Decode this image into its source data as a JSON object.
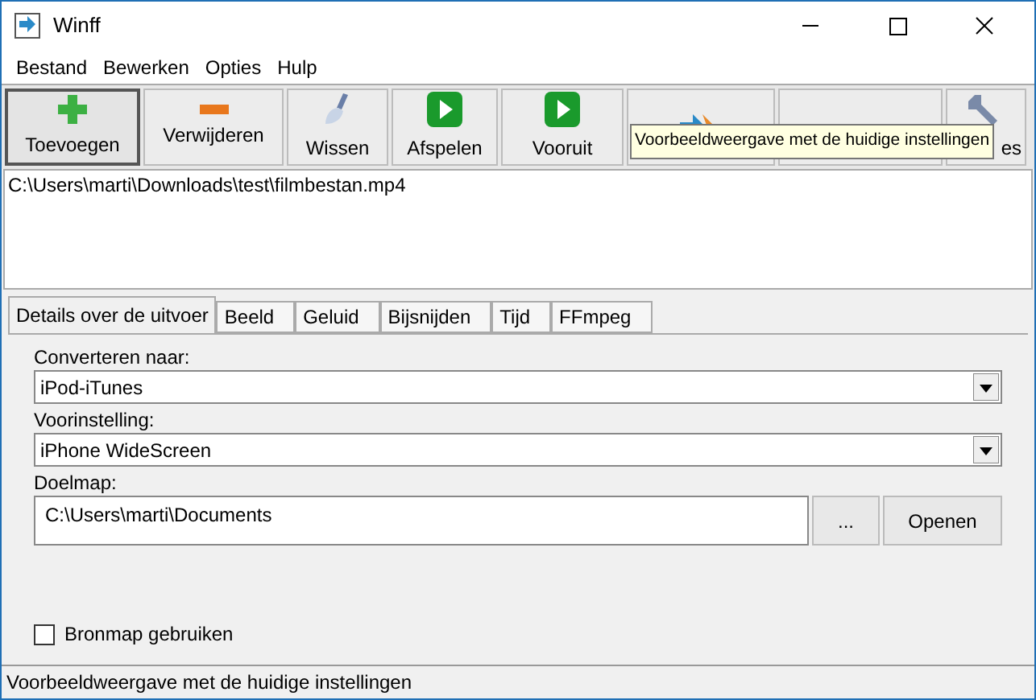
{
  "window": {
    "title": "Winff"
  },
  "menu": [
    "Bestand",
    "Bewerken",
    "Opties",
    "Hulp"
  ],
  "toolbar": [
    {
      "kind": "add",
      "label": "Toevoegen",
      "pressed": true
    },
    {
      "kind": "remove",
      "label": "Verwijderen",
      "pressed": false
    },
    {
      "kind": "clear",
      "label": "Wissen",
      "pressed": false
    },
    {
      "kind": "play",
      "label": "Afspelen",
      "pressed": false
    },
    {
      "kind": "play",
      "label": "Vooruit",
      "pressed": false
    },
    {
      "kind": "convert",
      "pressed": false
    },
    {
      "kind": "blank",
      "pressed": false
    },
    {
      "kind": "tools",
      "label": "es",
      "pressed": false
    }
  ],
  "tooltip": "Voorbeeldweergave met de huidige instellingen",
  "files": [
    "C:\\Users\\marti\\Downloads\\test\\filmbestan.mp4"
  ],
  "tabs": [
    {
      "label": "Details over de uitvoer",
      "selected": true
    },
    {
      "label": "Beeld",
      "selected": false
    },
    {
      "label": "Geluid",
      "selected": false
    },
    {
      "label": "Bijsnijden",
      "selected": false
    },
    {
      "label": "Tijd",
      "selected": false
    },
    {
      "label": "FFmpeg",
      "selected": false
    }
  ],
  "convert_to": {
    "label": "Converteren naar:",
    "value": "iPod-iTunes"
  },
  "preset": {
    "label": "Voorinstelling:",
    "value": "iPhone WideScreen"
  },
  "destination": {
    "label": "Doelmap:",
    "value": "C:\\Users\\marti\\Documents",
    "browse": "...",
    "open": "Openen"
  },
  "use_source_folder": {
    "label": "Bronmap gebruiken",
    "checked": false
  },
  "status_bar": "Voorbeeldweergave met de huidige instellingen"
}
